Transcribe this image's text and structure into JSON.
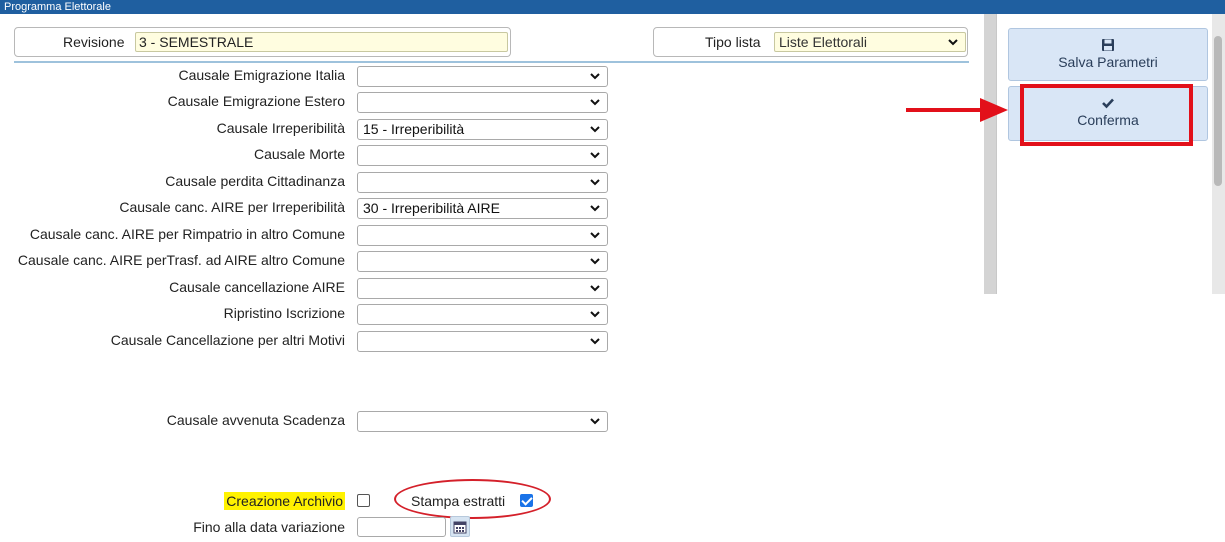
{
  "window": {
    "title": "Programma Elettorale"
  },
  "header": {
    "revisione_label": "Revisione",
    "revisione_value": "3 - SEMESTRALE",
    "tipo_lista_label": "Tipo lista",
    "tipo_lista_value": "Liste Elettorali"
  },
  "fields": [
    {
      "label": "Causale Emigrazione Italia",
      "value": ""
    },
    {
      "label": "Causale Emigrazione Estero",
      "value": ""
    },
    {
      "label": "Causale Irreperibilità",
      "value": "15 - Irreperibilità"
    },
    {
      "label": "Causale Morte",
      "value": ""
    },
    {
      "label": "Causale perdita Cittadinanza",
      "value": ""
    },
    {
      "label": "Causale canc. AIRE per Irreperibilità",
      "value": "30 - Irreperibilità AIRE"
    },
    {
      "label": "Causale canc. AIRE per Rimpatrio in altro Comune",
      "value": ""
    },
    {
      "label": "Causale canc. AIRE perTrasf. ad AIRE altro Comune",
      "value": ""
    },
    {
      "label": "Causale cancellazione AIRE",
      "value": ""
    },
    {
      "label": "Ripristino Iscrizione",
      "value": ""
    },
    {
      "label": "Causale Cancellazione per altri Motivi",
      "value": ""
    }
  ],
  "scadenza": {
    "label": "Causale avvenuta Scadenza",
    "value": ""
  },
  "options": {
    "creazione_archivio_label": "Creazione Archivio",
    "creazione_archivio_checked": false,
    "stampa_estratti_label": "Stampa estratti",
    "stampa_estratti_checked": true,
    "fino_data_label": "Fino alla data variazione",
    "fino_data_value": ""
  },
  "actions": {
    "salva_label": "Salva Parametri",
    "salva_icon": "floppy-disk-icon",
    "conferma_label": "Conferma",
    "conferma_icon": "checkmark-icon"
  },
  "colors": {
    "titlebar": "#1f5fa0",
    "highlight": "#fff200",
    "annotation_red": "#e2101a",
    "button_bg": "#d9e6f6"
  }
}
